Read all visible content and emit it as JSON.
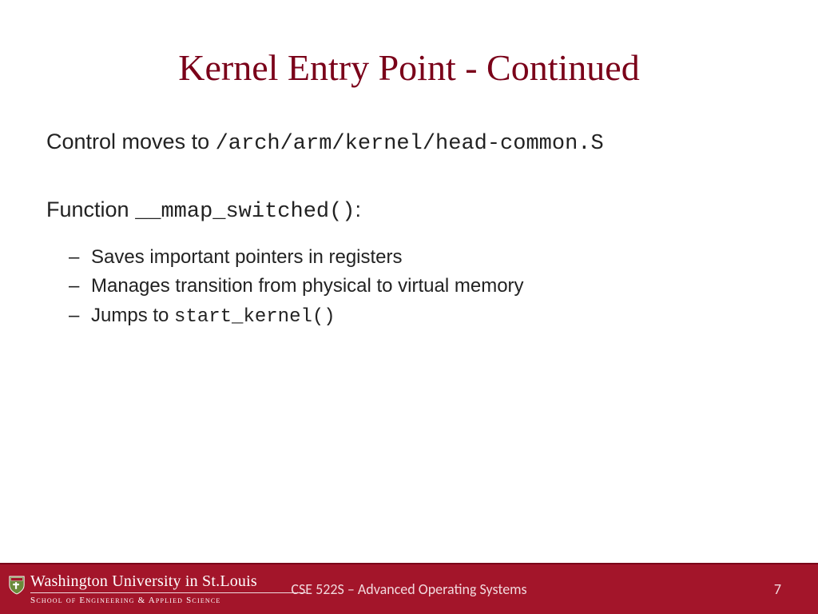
{
  "title": "Kernel Entry Point - Continued",
  "line1": {
    "prefix": "Control moves to ",
    "code": "/arch/arm/kernel/head-common.S"
  },
  "line2": {
    "prefix": "Function ",
    "code": "__mmap_switched()",
    "suffix": ":"
  },
  "bullets": {
    "b1": "Saves important pointers in registers",
    "b2": "Manages transition from physical to virtual memory",
    "b3_prefix": "Jumps to ",
    "b3_code": "start_kernel()"
  },
  "footer": {
    "university": "Washington University in St.Louis",
    "school": "School of Engineering & Applied Science",
    "course": "CSE 522S – Advanced Operating Systems",
    "page": "7"
  }
}
